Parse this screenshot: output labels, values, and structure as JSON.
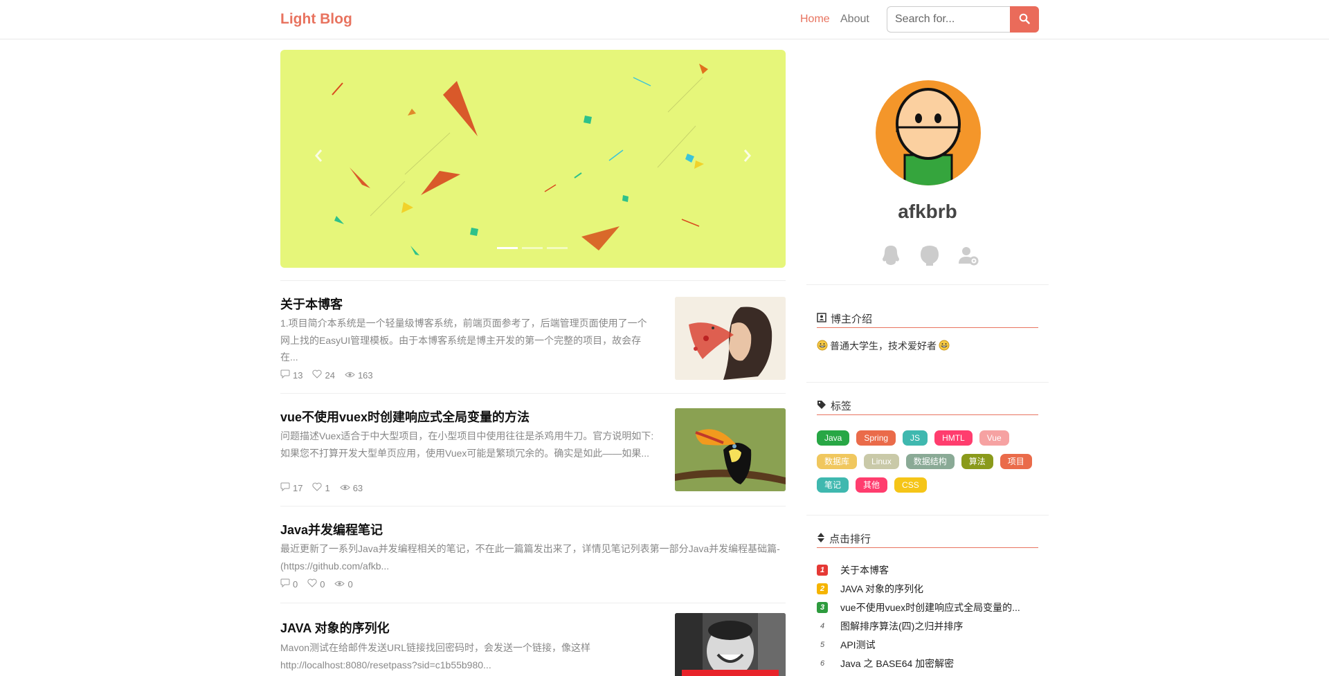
{
  "nav": {
    "brand": "Light Blog",
    "links": [
      "Home",
      "About"
    ],
    "search_placeholder": "Search for..."
  },
  "articles": [
    {
      "title": "关于本博客",
      "summary": "1.项目简介本系统是一个轻量级博客系统，前端页面参考了，后端管理页面使用了一个网上找的EasyUI管理模板。由于本博客系统是博主开发的第一个完整的项目，故会存在...",
      "comments": "13",
      "likes": "24",
      "views": "163",
      "thumbnail": "portrait"
    },
    {
      "title": "vue不使用vuex时创建响应式全局变量的方法",
      "summary": "问题描述Vuex适合于中大型项目，在小型项目中使用往往是杀鸡用牛刀。官方说明如下:如果您不打算开发大型单页应用，使用Vuex可能是繁琐冗余的。确实是如此——如果...",
      "comments": "17",
      "likes": "1",
      "views": "63",
      "thumbnail": "toucan"
    },
    {
      "title": "Java并发编程笔记",
      "summary": "最近更新了一系列Java并发编程相关的笔记，不在此一篇篇发出来了，详情见笔记列表第一部分Java并发编程基础篇-(https://github.com/afkb...",
      "comments": "0",
      "likes": "0",
      "views": "0",
      "thumbnail": ""
    },
    {
      "title": "JAVA 对象的序列化",
      "summary": "Mavon测试在给邮件发送URL链接找回密码时，会发送一个链接，像这样http://localhost:8080/resetpass?sid=c1b55b980...",
      "comments": "",
      "likes": "",
      "views": "",
      "thumbnail": "meme"
    }
  ],
  "profile": {
    "username": "afkbrb",
    "social_icons": [
      "qq-icon",
      "github-icon",
      "admin-settings-icon"
    ]
  },
  "about": {
    "heading": "博主介绍",
    "bio": "普通大学生，技术爱好者"
  },
  "tags_section": {
    "heading": "标签",
    "tags": [
      {
        "label": "Java",
        "color": "#28a745"
      },
      {
        "label": "Spring",
        "color": "#ea6b4a"
      },
      {
        "label": "JS",
        "color": "#3fb8af"
      },
      {
        "label": "HMTL",
        "color": "#ff3d6e"
      },
      {
        "label": "Vue",
        "color": "#f6a2a2"
      },
      {
        "label": "数据库",
        "color": "#f0c75e"
      },
      {
        "label": "Linux",
        "color": "#c9c9a8"
      },
      {
        "label": "数据结构",
        "color": "#8aaa96"
      },
      {
        "label": "算法",
        "color": "#8a9a1b"
      },
      {
        "label": "项目",
        "color": "#ea6b4a"
      },
      {
        "label": "笔记",
        "color": "#3fb8af"
      },
      {
        "label": "其他",
        "color": "#ff3d6e"
      },
      {
        "label": "CSS",
        "color": "#f5c518"
      }
    ]
  },
  "ranking": {
    "heading": "点击排行",
    "items": [
      {
        "rank": "1",
        "title": "关于本博客",
        "color": "#e53935"
      },
      {
        "rank": "2",
        "title": "JAVA 对象的序列化",
        "color": "#f5b400"
      },
      {
        "rank": "3",
        "title": "vue不使用vuex时创建响应式全局变量的...",
        "color": "#2e9b3e"
      },
      {
        "rank": "4",
        "title": "图解排序算法(四)之归并排序",
        "color": ""
      },
      {
        "rank": "5",
        "title": "API测试",
        "color": ""
      },
      {
        "rank": "6",
        "title": "Java 之 BASE64 加密解密",
        "color": ""
      }
    ]
  },
  "colors": {
    "accent": "#e8735f",
    "carousel_bg": "#e6f67a"
  }
}
